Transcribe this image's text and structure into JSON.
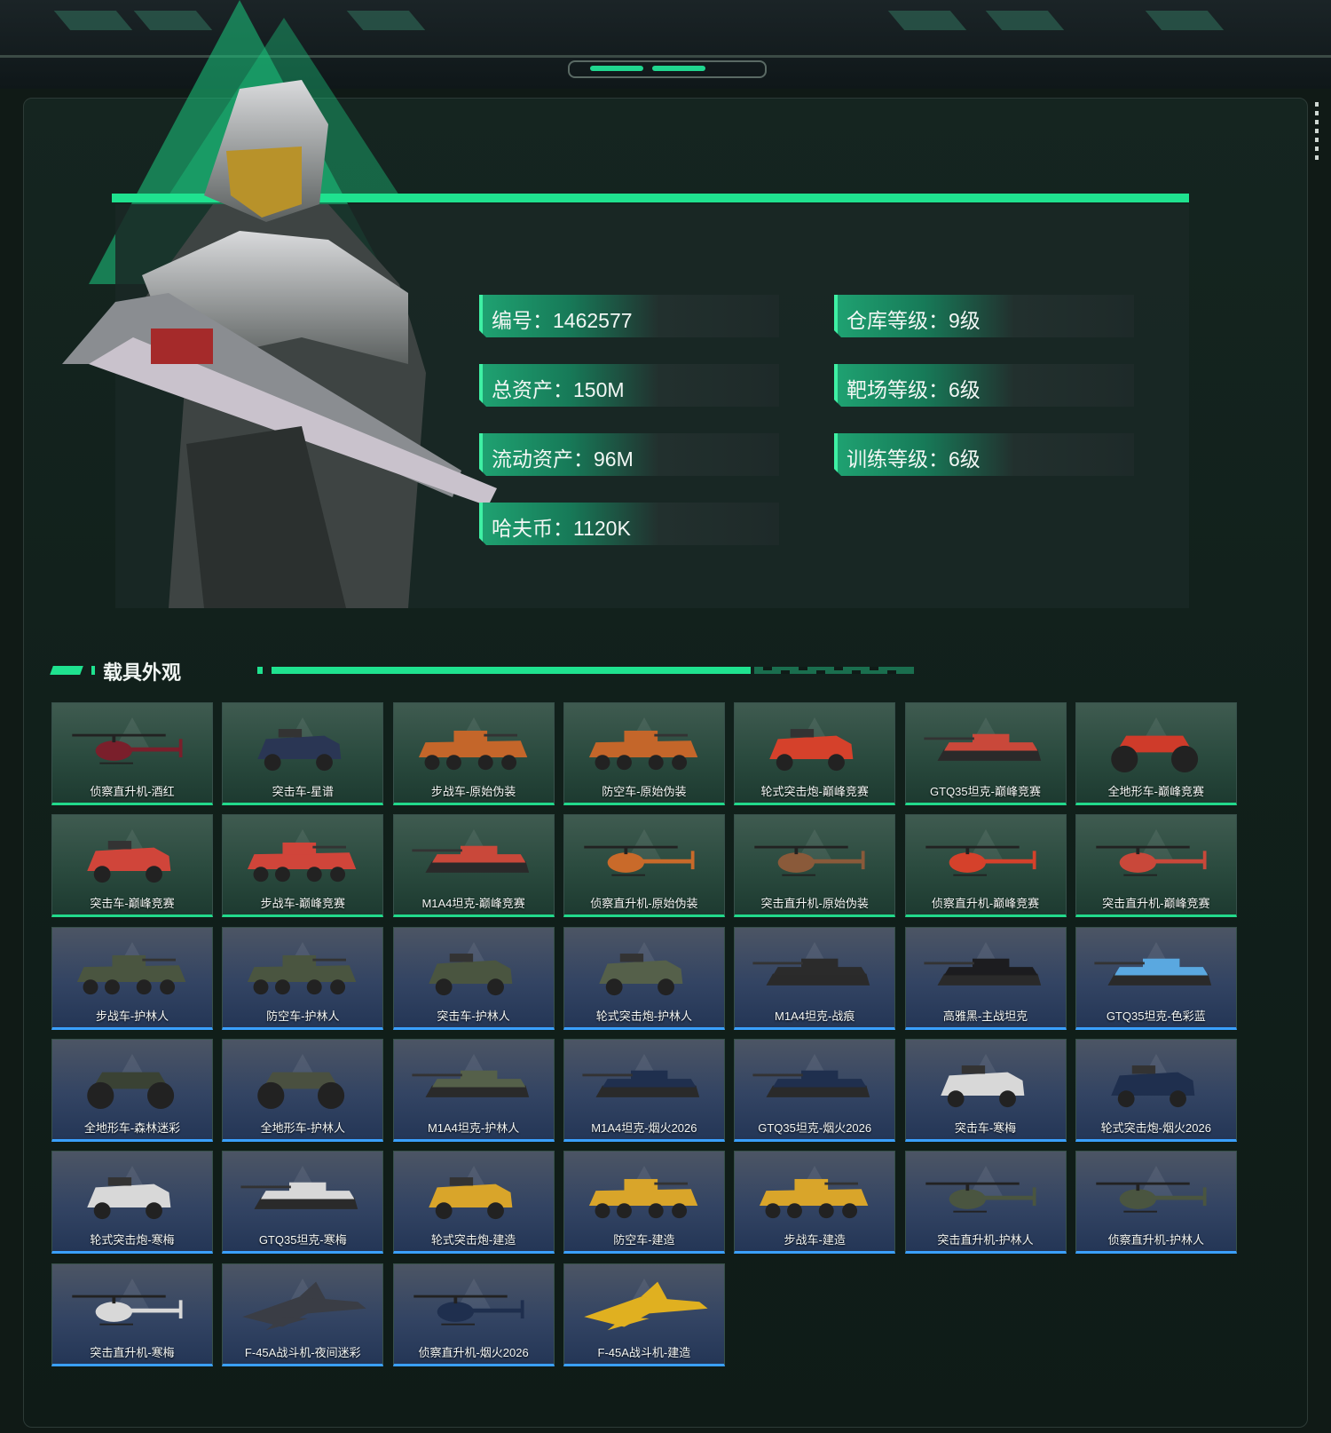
{
  "profile": {
    "stats": [
      {
        "label": "编号：1462577"
      },
      {
        "label": "仓库等级：9级"
      },
      {
        "label": "总资产：150M"
      },
      {
        "label": "靶场等级：6级"
      },
      {
        "label": "流动资产：96M"
      },
      {
        "label": "训练等级：6级"
      },
      {
        "label": "哈夫币：1120K"
      }
    ]
  },
  "section": {
    "title": "载具外观"
  },
  "vehicles": [
    {
      "name": "侦察直升机-酒红",
      "kind": "heli",
      "rarity": "green",
      "color": "#7a1f2b"
    },
    {
      "name": "突击车-星谱",
      "kind": "car",
      "rarity": "green",
      "color": "#2a3654"
    },
    {
      "name": "步战车-原始伪装",
      "kind": "ifv",
      "rarity": "green",
      "color": "#c4662a"
    },
    {
      "name": "防空车-原始伪装",
      "kind": "ifv",
      "rarity": "green",
      "color": "#c4662a"
    },
    {
      "name": "轮式突击炮-巅峰竞赛",
      "kind": "car",
      "rarity": "green",
      "color": "#d5412b"
    },
    {
      "name": "GTQ35坦克-巅峰竞赛",
      "kind": "tank",
      "rarity": "green",
      "color": "#c9483a"
    },
    {
      "name": "全地形车-巅峰竞赛",
      "kind": "atv",
      "rarity": "green",
      "color": "#cf3b2a"
    },
    {
      "name": "突击车-巅峰竞赛",
      "kind": "car",
      "rarity": "green",
      "color": "#d0453a"
    },
    {
      "name": "步战车-巅峰竞赛",
      "kind": "ifv",
      "rarity": "green",
      "color": "#d0453a"
    },
    {
      "name": "M1A4坦克-巅峰竞赛",
      "kind": "tank",
      "rarity": "green",
      "color": "#c9483a"
    },
    {
      "name": "侦察直升机-原始伪装",
      "kind": "heli",
      "rarity": "green",
      "color": "#c96a2a"
    },
    {
      "name": "突击直升机-原始伪装",
      "kind": "heli",
      "rarity": "green",
      "color": "#8a5a3a"
    },
    {
      "name": "侦察直升机-巅峰竞赛",
      "kind": "heli",
      "rarity": "green",
      "color": "#d5412b"
    },
    {
      "name": "突击直升机-巅峰竞赛",
      "kind": "heli",
      "rarity": "green",
      "color": "#c9483a"
    },
    {
      "name": "步战车-护林人",
      "kind": "ifv",
      "rarity": "blue",
      "color": "#4a5540"
    },
    {
      "name": "防空车-护林人",
      "kind": "ifv",
      "rarity": "blue",
      "color": "#4a5540"
    },
    {
      "name": "突击车-护林人",
      "kind": "car",
      "rarity": "blue",
      "color": "#4a5540"
    },
    {
      "name": "轮式突击炮-护林人",
      "kind": "car",
      "rarity": "blue",
      "color": "#55604a"
    },
    {
      "name": "M1A4坦克-战痕",
      "kind": "tank",
      "rarity": "blue",
      "color": "#2b2b2b"
    },
    {
      "name": "高雅黑-主战坦克",
      "kind": "tank",
      "rarity": "blue",
      "color": "#1c1c1f"
    },
    {
      "name": "GTQ35坦克-色彩蓝",
      "kind": "tank",
      "rarity": "blue",
      "color": "#5aa8e0"
    },
    {
      "name": "全地形车-森林迷彩",
      "kind": "atv",
      "rarity": "blue",
      "color": "#3a4234"
    },
    {
      "name": "全地形车-护林人",
      "kind": "atv",
      "rarity": "blue",
      "color": "#4a5040"
    },
    {
      "name": "M1A4坦克-护林人",
      "kind": "tank",
      "rarity": "blue",
      "color": "#55604a"
    },
    {
      "name": "M1A4坦克-烟火2026",
      "kind": "tank",
      "rarity": "blue",
      "color": "#1f2f4e"
    },
    {
      "name": "GTQ35坦克-烟火2026",
      "kind": "tank",
      "rarity": "blue",
      "color": "#1f2f4e"
    },
    {
      "name": "突击车-寒梅",
      "kind": "car",
      "rarity": "blue",
      "color": "#d8d8d8"
    },
    {
      "name": "轮式突击炮-烟火2026",
      "kind": "car",
      "rarity": "blue",
      "color": "#1f2f4e"
    },
    {
      "name": "轮式突击炮-寒梅",
      "kind": "car",
      "rarity": "blue",
      "color": "#d8d8d8"
    },
    {
      "name": "GTQ35坦克-寒梅",
      "kind": "tank",
      "rarity": "blue",
      "color": "#d8d8d8"
    },
    {
      "name": "轮式突击炮-建造",
      "kind": "car",
      "rarity": "blue",
      "color": "#d9a52a"
    },
    {
      "name": "防空车-建造",
      "kind": "ifv",
      "rarity": "blue",
      "color": "#d9a52a"
    },
    {
      "name": "步战车-建造",
      "kind": "ifv",
      "rarity": "blue",
      "color": "#d9a52a"
    },
    {
      "name": "突击直升机-护林人",
      "kind": "heli",
      "rarity": "blue",
      "color": "#4a5540"
    },
    {
      "name": "侦察直升机-护林人",
      "kind": "heli",
      "rarity": "blue",
      "color": "#4a5540"
    },
    {
      "name": "突击直升机-寒梅",
      "kind": "heli",
      "rarity": "blue",
      "color": "#d8d8d8"
    },
    {
      "name": "F-45A战斗机-夜间迷彩",
      "kind": "jet",
      "rarity": "blue",
      "color": "#3a3d45"
    },
    {
      "name": "侦察直升机-烟火2026",
      "kind": "heli",
      "rarity": "blue",
      "color": "#1f2f4e"
    },
    {
      "name": "F-45A战斗机-建造",
      "kind": "jet",
      "rarity": "blue",
      "color": "#e0b020"
    }
  ]
}
